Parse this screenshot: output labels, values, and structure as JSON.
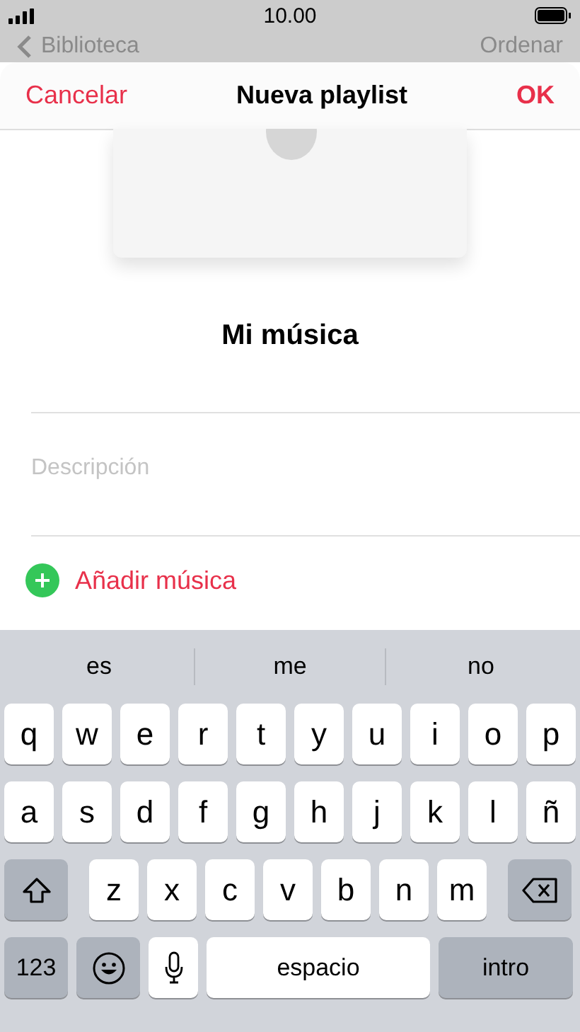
{
  "status_bar": {
    "time": "10.00"
  },
  "background_nav": {
    "back": "Biblioteca",
    "action": "Ordenar"
  },
  "sheet": {
    "cancel": "Cancelar",
    "title": "Nueva playlist",
    "done": "OK"
  },
  "playlist": {
    "name": "Mi música",
    "description": {
      "placeholder": "Descripción"
    },
    "add_music": "Añadir música"
  },
  "keyboard": {
    "suggestions": [
      "es",
      "me",
      "no"
    ],
    "rows": [
      {
        "keys": [
          {
            "kind": "letter",
            "label": "q"
          },
          {
            "kind": "letter",
            "label": "w"
          },
          {
            "kind": "letter",
            "label": "e"
          },
          {
            "kind": "letter",
            "label": "r"
          },
          {
            "kind": "letter",
            "label": "t"
          },
          {
            "kind": "letter",
            "label": "y"
          },
          {
            "kind": "letter",
            "label": "u"
          },
          {
            "kind": "letter",
            "label": "i"
          },
          {
            "kind": "letter",
            "label": "o"
          },
          {
            "kind": "letter",
            "label": "p"
          }
        ]
      },
      {
        "keys": [
          {
            "kind": "letter",
            "label": "a"
          },
          {
            "kind": "letter",
            "label": "s"
          },
          {
            "kind": "letter",
            "label": "d"
          },
          {
            "kind": "letter",
            "label": "f"
          },
          {
            "kind": "letter",
            "label": "g"
          },
          {
            "kind": "letter",
            "label": "h"
          },
          {
            "kind": "letter",
            "label": "j"
          },
          {
            "kind": "letter",
            "label": "k"
          },
          {
            "kind": "letter",
            "label": "l"
          },
          {
            "kind": "letter",
            "label": "ñ"
          }
        ]
      },
      {
        "keys": [
          {
            "kind": "shift"
          },
          {
            "kind": "letter",
            "label": "z"
          },
          {
            "kind": "letter",
            "label": "x"
          },
          {
            "kind": "letter",
            "label": "c"
          },
          {
            "kind": "letter",
            "label": "v"
          },
          {
            "kind": "letter",
            "label": "b"
          },
          {
            "kind": "letter",
            "label": "n"
          },
          {
            "kind": "letter",
            "label": "m"
          },
          {
            "kind": "delete"
          }
        ]
      },
      {
        "keys": [
          {
            "kind": "numbers",
            "label": "123"
          },
          {
            "kind": "emoji"
          },
          {
            "kind": "mic"
          },
          {
            "kind": "space",
            "label": "espacio"
          },
          {
            "kind": "return",
            "label": "intro"
          }
        ]
      }
    ]
  }
}
